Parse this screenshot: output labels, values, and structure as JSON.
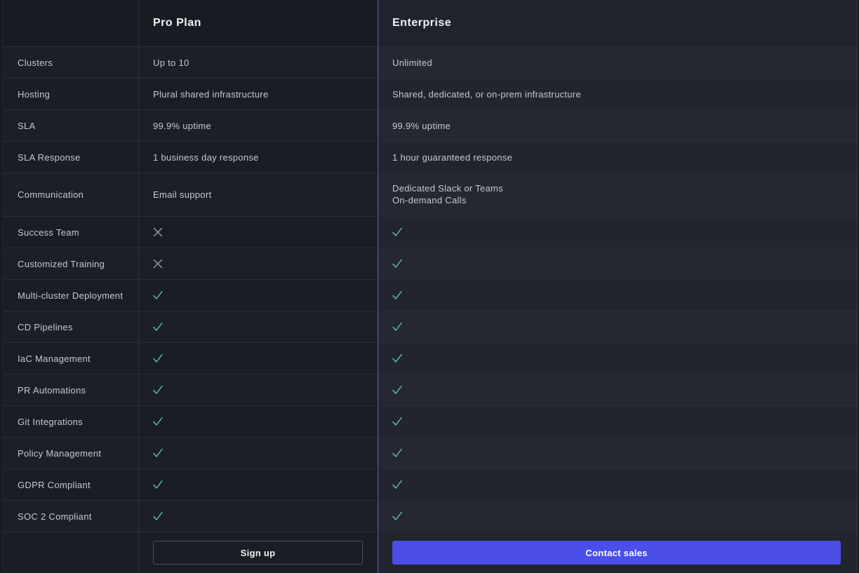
{
  "plans": {
    "pro": {
      "name": "Pro Plan",
      "cta": "Sign up"
    },
    "enterprise": {
      "name": "Enterprise",
      "cta": "Contact sales"
    }
  },
  "colors": {
    "check": "#5fc9a0",
    "cross": "#9a9ea8",
    "primary_button": "#4a4fe8",
    "column_divider": "#5b5fd6"
  },
  "rows": [
    {
      "feature": "Clusters",
      "pro": "Up to 10",
      "enterprise": "Unlimited"
    },
    {
      "feature": "Hosting",
      "pro": "Plural shared infrastructure",
      "enterprise": "Shared, dedicated, or on-prem infrastructure"
    },
    {
      "feature": "SLA",
      "pro": "99.9% uptime",
      "enterprise": "99.9% uptime"
    },
    {
      "feature": "SLA Response",
      "pro": "1 business day response",
      "enterprise": "1 hour guaranteed response"
    },
    {
      "feature": "Communication",
      "pro": "Email support",
      "enterprise_lines": [
        "Dedicated Slack or Teams",
        "On-demand Calls"
      ]
    },
    {
      "feature": "Success Team",
      "pro_icon": "cross-icon",
      "enterprise_icon": "check-icon"
    },
    {
      "feature": "Customized Training",
      "pro_icon": "cross-icon",
      "enterprise_icon": "check-icon"
    },
    {
      "feature": "Multi-cluster Deployment",
      "pro_icon": "check-icon",
      "enterprise_icon": "check-icon"
    },
    {
      "feature": "CD Pipelines",
      "pro_icon": "check-icon",
      "enterprise_icon": "check-icon"
    },
    {
      "feature": "IaC Management",
      "pro_icon": "check-icon",
      "enterprise_icon": "check-icon"
    },
    {
      "feature": "PR Automations",
      "pro_icon": "check-icon",
      "enterprise_icon": "check-icon"
    },
    {
      "feature": "Git Integrations",
      "pro_icon": "check-icon",
      "enterprise_icon": "check-icon"
    },
    {
      "feature": "Policy Management",
      "pro_icon": "check-icon",
      "enterprise_icon": "check-icon"
    },
    {
      "feature": "GDPR Compliant",
      "pro_icon": "check-icon",
      "enterprise_icon": "check-icon"
    },
    {
      "feature": "SOC 2 Compliant",
      "pro_icon": "check-icon",
      "enterprise_icon": "check-icon"
    }
  ]
}
